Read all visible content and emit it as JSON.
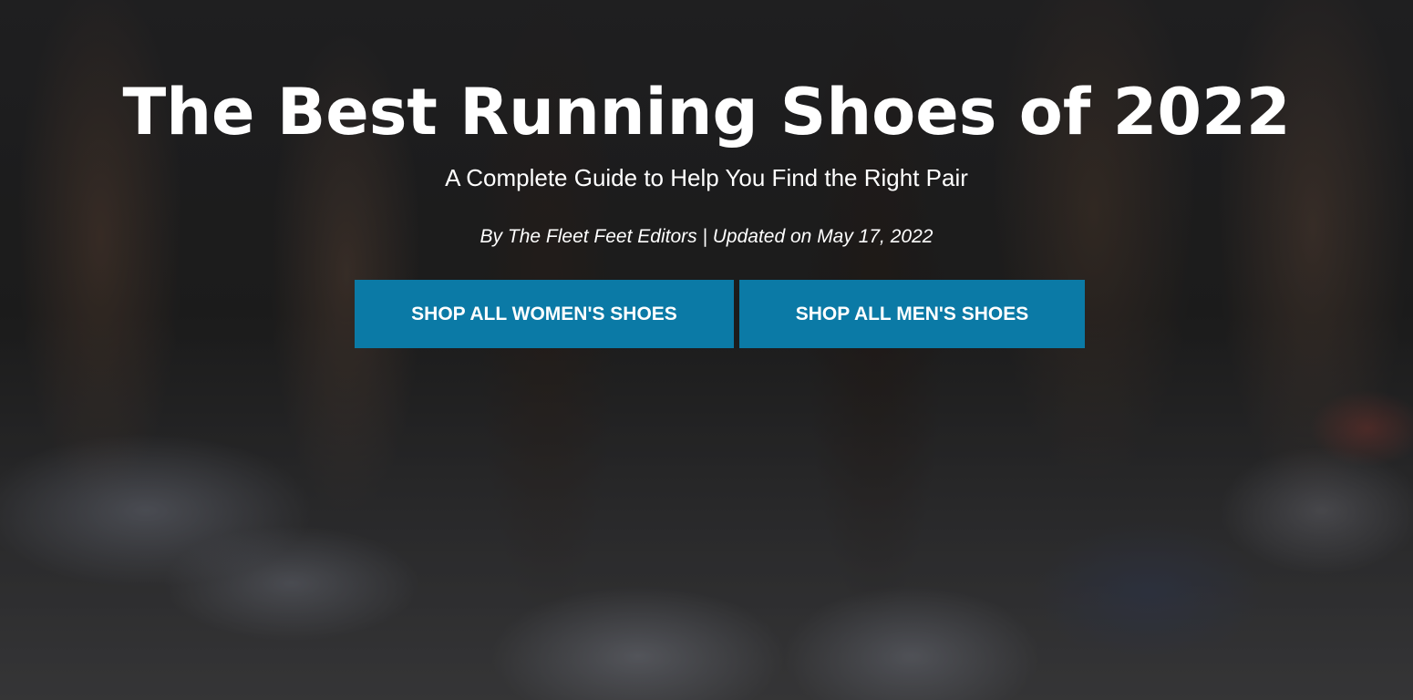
{
  "hero": {
    "title": "The Best Running Shoes of 2022",
    "subtitle": "A Complete Guide to Help You Find the Right Pair",
    "byline": "By The Fleet Feet Editors | Updated on May 17, 2022",
    "buttons": [
      {
        "label": "SHOP ALL WOMEN'S SHOES"
      },
      {
        "label": "SHOP ALL MEN'S SHOES"
      }
    ]
  },
  "colors": {
    "button_bg": "#0b7aa6",
    "text": "#ffffff"
  }
}
